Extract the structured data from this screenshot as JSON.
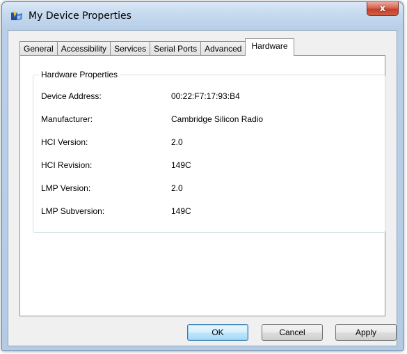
{
  "window": {
    "title": "My Device Properties",
    "close_symbol": "x",
    "icon": "bluetooth-device-icon"
  },
  "tabs": [
    {
      "label": "General",
      "active": false
    },
    {
      "label": "Accessibility",
      "active": false
    },
    {
      "label": "Services",
      "active": false
    },
    {
      "label": "Serial Ports",
      "active": false
    },
    {
      "label": "Advanced",
      "active": false
    },
    {
      "label": "Hardware",
      "active": true
    }
  ],
  "hardware": {
    "group_title": "Hardware Properties",
    "properties": [
      {
        "label": "Device Address:",
        "value": "00:22:F7:17:93:B4"
      },
      {
        "label": "Manufacturer:",
        "value": "Cambridge Silicon Radio"
      },
      {
        "label": "HCI Version:",
        "value": "2.0"
      },
      {
        "label": "HCI Revision:",
        "value": "149C"
      },
      {
        "label": "LMP Version:",
        "value": "2.0"
      },
      {
        "label": "LMP Subversion:",
        "value": "149C"
      }
    ]
  },
  "buttons": {
    "ok": "OK",
    "cancel": "Cancel",
    "apply": "Apply"
  },
  "colors": {
    "close_button": "#c4402a",
    "default_button_border": "#3c7fb1"
  }
}
